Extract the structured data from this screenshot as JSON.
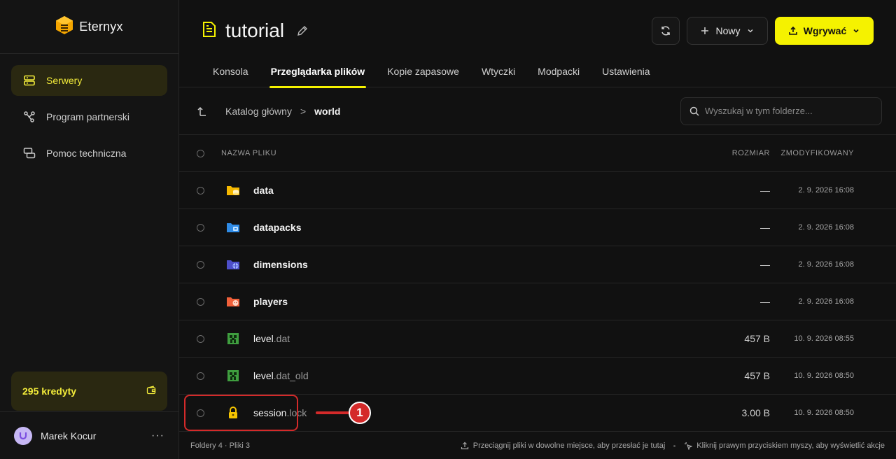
{
  "brand": {
    "name": "Eternyx"
  },
  "sidebar": {
    "items": [
      {
        "label": "Serwery",
        "icon": "server-icon",
        "active": true
      },
      {
        "label": "Program partnerski",
        "icon": "share-nodes-icon",
        "active": false
      },
      {
        "label": "Pomoc techniczna",
        "icon": "chat-icon",
        "active": false
      }
    ],
    "credits": {
      "label": "295 kredyty"
    },
    "user": {
      "name": "Marek Kocur",
      "menu": "···"
    }
  },
  "header": {
    "title": "tutorial",
    "new_label": "Nowy",
    "upload_label": "Wgrywać"
  },
  "tabs": [
    {
      "label": "Konsola",
      "active": false
    },
    {
      "label": "Przeglądarka plików",
      "active": true
    },
    {
      "label": "Kopie zapasowe",
      "active": false
    },
    {
      "label": "Wtyczki",
      "active": false
    },
    {
      "label": "Modpacki",
      "active": false
    },
    {
      "label": "Ustawienia",
      "active": false
    }
  ],
  "breadcrumb": {
    "root": "Katalog główny",
    "separator": ">",
    "current": "world"
  },
  "search": {
    "placeholder": "Wyszukaj w tym folderze..."
  },
  "table": {
    "headers": {
      "name": "NAZWA PLIKU",
      "size": "ROZMIAR",
      "modified": "ZMODYFIKOWANY"
    },
    "rows": [
      {
        "name": "data",
        "ext": "",
        "icon": "folder-data-icon",
        "size": "—",
        "modified": "2. 9. 2026 16:08"
      },
      {
        "name": "datapacks",
        "ext": "",
        "icon": "folder-datapacks-icon",
        "size": "—",
        "modified": "2. 9. 2026 16:08"
      },
      {
        "name": "dimensions",
        "ext": "",
        "icon": "folder-dimensions-icon",
        "size": "—",
        "modified": "2. 9. 2026 16:08"
      },
      {
        "name": "players",
        "ext": "",
        "icon": "folder-players-icon",
        "size": "—",
        "modified": "2. 9. 2026 16:08"
      },
      {
        "name": "level",
        "ext": ".dat",
        "icon": "minecraft-file-icon",
        "size": "457 B",
        "modified": "10. 9. 2026 08:55"
      },
      {
        "name": "level",
        "ext": ".dat_old",
        "icon": "minecraft-file-icon",
        "size": "457 B",
        "modified": "10. 9. 2026 08:50"
      },
      {
        "name": "session",
        "ext": ".lock",
        "icon": "lock-icon",
        "size": "3.00 B",
        "modified": "10. 9. 2026 08:50"
      }
    ]
  },
  "footer": {
    "counts": "Foldery 4 · Pliki 3",
    "drag_hint": "Przeciągnij pliki w dowolne miejsce, aby przesłać je tutaj",
    "context_hint": "Kliknij prawym przyciskiem myszy, aby wyświetlić akcje"
  },
  "annotation": {
    "badge": "1"
  },
  "colors": {
    "accent": "#f5f200",
    "annotation": "#d42a2a",
    "background": "#111111"
  }
}
